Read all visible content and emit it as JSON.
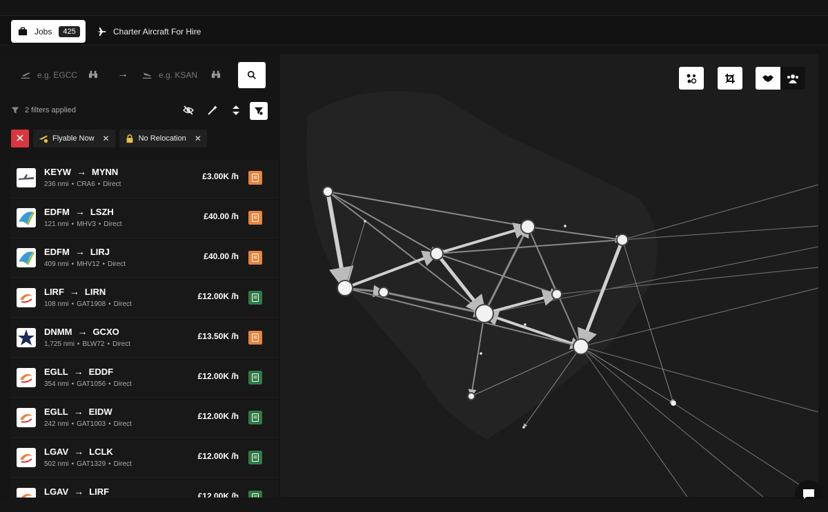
{
  "tabs": {
    "jobs_label": "Jobs",
    "jobs_count": "425",
    "charter_label": "Charter Aircraft For Hire"
  },
  "search": {
    "from_placeholder": "e.g. EGCC",
    "to_placeholder": "e.g. KSAN"
  },
  "filters": {
    "summary": "2 filters applied",
    "chips": [
      "Flyable Now",
      "No Relocation"
    ]
  },
  "jobs": [
    {
      "from": "KEYW",
      "to": "MYNN",
      "distance": "236 nmi",
      "aircraft": "CRA6",
      "type": "Direct",
      "price": "£3.00K /h",
      "tag": "orange",
      "logo": "plane"
    },
    {
      "from": "EDFM",
      "to": "LSZH",
      "distance": "121 nmi",
      "aircraft": "MHV3",
      "type": "Direct",
      "price": "£40.00 /h",
      "tag": "orange",
      "logo": "bird"
    },
    {
      "from": "EDFM",
      "to": "LIRJ",
      "distance": "409 nmi",
      "aircraft": "MHV12",
      "type": "Direct",
      "price": "£40.00 /h",
      "tag": "orange",
      "logo": "bird"
    },
    {
      "from": "LIRF",
      "to": "LIRN",
      "distance": "108 nmi",
      "aircraft": "GAT1908",
      "type": "Direct",
      "price": "£12.00K /h",
      "tag": "green",
      "logo": "swirl"
    },
    {
      "from": "DNMM",
      "to": "GCXO",
      "distance": "1,725 nmi",
      "aircraft": "BLW72",
      "type": "Direct",
      "price": "£13.50K /h",
      "tag": "orange",
      "logo": "star"
    },
    {
      "from": "EGLL",
      "to": "EDDF",
      "distance": "354 nmi",
      "aircraft": "GAT1056",
      "type": "Direct",
      "price": "£12.00K /h",
      "tag": "green",
      "logo": "swirl"
    },
    {
      "from": "EGLL",
      "to": "EIDW",
      "distance": "242 nmi",
      "aircraft": "GAT1003",
      "type": "Direct",
      "price": "£12.00K /h",
      "tag": "green",
      "logo": "swirl"
    },
    {
      "from": "LGAV",
      "to": "LCLK",
      "distance": "502 nmi",
      "aircraft": "GAT1329",
      "type": "Direct",
      "price": "£12.00K /h",
      "tag": "green",
      "logo": "swirl"
    },
    {
      "from": "LGAV",
      "to": "LIRF",
      "distance": "",
      "aircraft": "",
      "type": "",
      "price": "£12.00K /h",
      "tag": "green",
      "logo": "swirl"
    }
  ],
  "colors": {
    "orange_tag": "#e8843c",
    "green_tag": "#2f7a44",
    "clear_red": "#d9363e"
  }
}
